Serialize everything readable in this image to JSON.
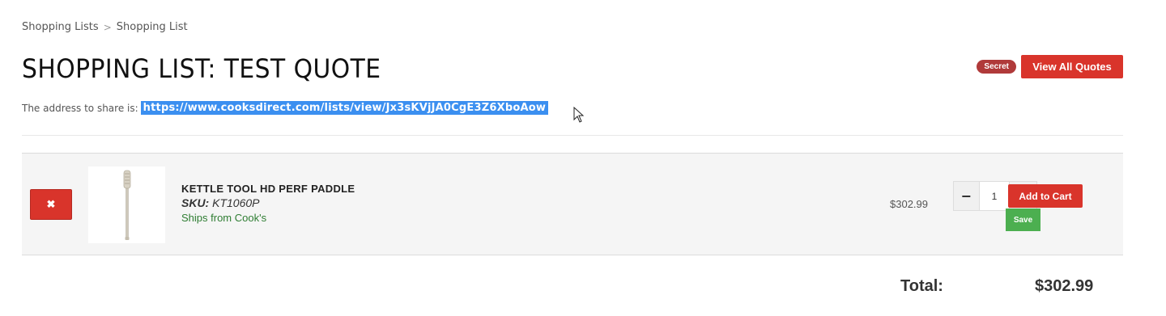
{
  "breadcrumb": {
    "items": [
      "Shopping Lists",
      "Shopping List"
    ],
    "separator": ">"
  },
  "page": {
    "title": "SHOPPING LIST: TEST QUOTE"
  },
  "actions": {
    "secret_badge": "Secret",
    "view_all_quotes": "View All Quotes"
  },
  "share": {
    "label": "The address to share is:",
    "url": "https://www.cooksdirect.com/lists/view/Jx3sKVjJA0CgE3Z6XboAow"
  },
  "items": [
    {
      "remove_icon": "close-icon",
      "image_icon": "kettle-paddle-image",
      "name": "KETTLE TOOL HD PERF PADDLE",
      "sku_label": "SKU:",
      "sku": "KT1060P",
      "ships": "Ships from Cook's",
      "price": "$302.99",
      "quantity": "1",
      "minus_label": "−",
      "add_to_cart": "Add to Cart",
      "save": "Save"
    }
  ],
  "totals": {
    "label": "Total:",
    "value": "$302.99"
  },
  "colors": {
    "accent_red": "#d9342b",
    "secret_badge": "#b03a3a",
    "save_green": "#4caf50",
    "ships_green": "#2e7d32",
    "selection_blue": "#3b8ff0"
  }
}
